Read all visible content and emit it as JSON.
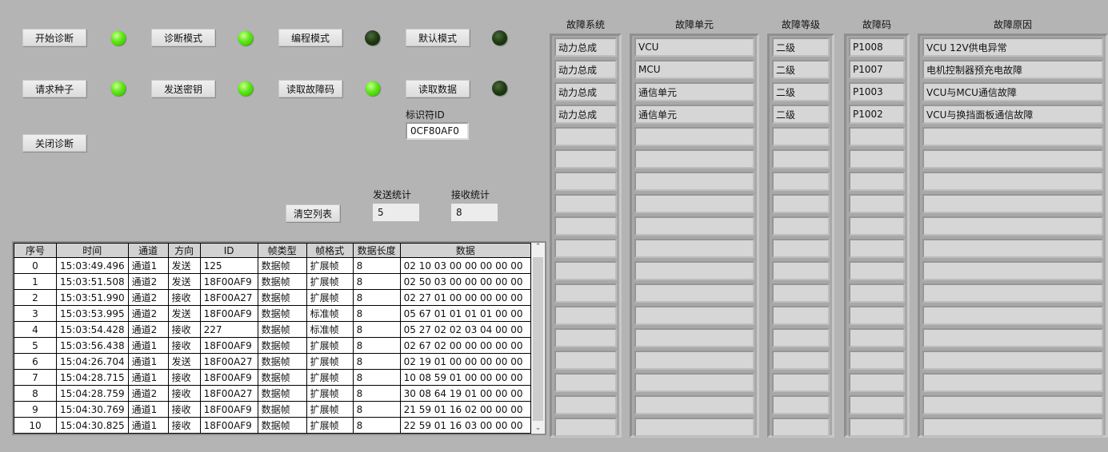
{
  "buttons": {
    "start_diag": "开始诊断",
    "diag_mode": "诊断模式",
    "prog_mode": "编程模式",
    "default_mode": "默认模式",
    "request_seed": "请求种子",
    "send_key": "发送密钥",
    "read_dtc": "读取故障码",
    "read_data": "读取数据",
    "close_diag": "关闭诊断",
    "clear_list": "清空列表"
  },
  "leds": {
    "start_diag": true,
    "diag_mode": true,
    "prog_mode": false,
    "default_mode": false,
    "request_seed": true,
    "send_key": true,
    "read_dtc": true,
    "read_data": false
  },
  "identifier": {
    "label": "标识符ID",
    "value": "0CF80AF0"
  },
  "stats": {
    "send_label": "发送统计",
    "send_value": "5",
    "recv_label": "接收统计",
    "recv_value": "8"
  },
  "table": {
    "headers": [
      "序号",
      "时间",
      "通道",
      "方向",
      "ID",
      "帧类型",
      "帧格式",
      "数据长度",
      "数据"
    ],
    "rows": [
      [
        "0",
        "15:03:49.496",
        "通道1",
        "发送",
        "125",
        "数据帧",
        "扩展帧",
        "8",
        "02 10 03 00 00 00 00 00"
      ],
      [
        "1",
        "15:03:51.508",
        "通道2",
        "发送",
        "18F00AF9",
        "数据帧",
        "扩展帧",
        "8",
        "02 50 03 00 00 00 00 00"
      ],
      [
        "2",
        "15:03:51.990",
        "通道2",
        "接收",
        "18F00A27",
        "数据帧",
        "扩展帧",
        "8",
        "02 27 01 00 00 00 00 00"
      ],
      [
        "3",
        "15:03:53.995",
        "通道2",
        "发送",
        "18F00AF9",
        "数据帧",
        "标准帧",
        "8",
        "05 67 01 01 01 01 00 00"
      ],
      [
        "4",
        "15:03:54.428",
        "通道2",
        "接收",
        "227",
        "数据帧",
        "标准帧",
        "8",
        "05 27 02 02 03 04 00 00"
      ],
      [
        "5",
        "15:03:56.438",
        "通道1",
        "接收",
        "18F00AF9",
        "数据帧",
        "扩展帧",
        "8",
        "02 67 02 00 00 00 00 00"
      ],
      [
        "6",
        "15:04:26.704",
        "通道1",
        "发送",
        "18F00A27",
        "数据帧",
        "扩展帧",
        "8",
        "02 19 01 00 00 00 00 00"
      ],
      [
        "7",
        "15:04:28.715",
        "通道1",
        "接收",
        "18F00AF9",
        "数据帧",
        "扩展帧",
        "8",
        "10 08 59 01 00 00 00 00"
      ],
      [
        "8",
        "15:04:28.759",
        "通道2",
        "接收",
        "18F00A27",
        "数据帧",
        "扩展帧",
        "8",
        "30 08 64 19 01 00 00 00"
      ],
      [
        "9",
        "15:04:30.769",
        "通道1",
        "接收",
        "18F00AF9",
        "数据帧",
        "扩展帧",
        "8",
        "21 59 01 16 02 00 00 00"
      ],
      [
        "10",
        "15:04:30.825",
        "通道1",
        "接收",
        "18F00AF9",
        "数据帧",
        "扩展帧",
        "8",
        "22 59 01 16 03 00 00 00"
      ]
    ]
  },
  "faults": {
    "columns": [
      {
        "header": "故障系统",
        "values": [
          "动力总成",
          "动力总成",
          "动力总成",
          "动力总成"
        ]
      },
      {
        "header": "故障单元",
        "values": [
          "VCU",
          "MCU",
          "通信单元",
          "通信单元"
        ]
      },
      {
        "header": "故障等级",
        "values": [
          "二级",
          "二级",
          "二级",
          "二级"
        ]
      },
      {
        "header": "故障码",
        "values": [
          "P1008",
          "P1007",
          "P1003",
          "P1002"
        ]
      },
      {
        "header": "故障原因",
        "values": [
          "VCU 12V供电异常",
          "电机控制器预充电故障",
          "VCU与MCU通信故障",
          "VCU与换挡面板通信故障"
        ]
      }
    ]
  }
}
